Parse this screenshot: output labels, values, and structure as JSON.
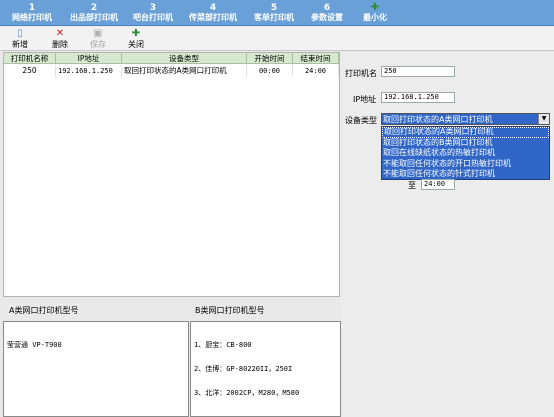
{
  "tabs": [
    {
      "num": "1",
      "label": "网络打印机"
    },
    {
      "num": "2",
      "label": "出品部打印机"
    },
    {
      "num": "3",
      "label": "吧台打印机"
    },
    {
      "num": "4",
      "label": "传菜部打印机"
    },
    {
      "num": "5",
      "label": "客单打印机"
    },
    {
      "num": "6",
      "label": "参数设置"
    },
    {
      "label": "最小化"
    }
  ],
  "toolbar": {
    "new": "新增",
    "delete": "删除",
    "save": "保存",
    "close": "关闭"
  },
  "table": {
    "headers": [
      "打印机名称",
      "IP地址",
      "设备类型",
      "开始时间",
      "结束时间"
    ],
    "rows": [
      [
        "250",
        "192.168.1.250",
        "取回打印状态的A类网口打印机",
        "00:00",
        "24:00"
      ]
    ]
  },
  "models": {
    "a_title": "A类网口打印机型号",
    "b_title": "B类网口打印机型号",
    "a_text": "莹营通 VP-T900",
    "b_lines": [
      "1、厨宝：CB-800",
      "2、佳博：GP-80220II，250I",
      "3、北洋：2002CP，M280，M580"
    ]
  },
  "form": {
    "name_label": "打印机名",
    "name_value": "250",
    "ip_label": "IP地址",
    "ip_value": "192.168.1.250",
    "type_label": "设备类型",
    "type_value": "取回打印状态的A类网口打印机",
    "end_label": "至",
    "end_value": "24:00",
    "options": [
      "取回打印状态的A类网口打印机",
      "取回打印状态的B类网口打印机",
      "取回在线缺纸状态的热敏打印机",
      "不能取回任何状态的开口热敏打印机",
      "不能取回任何状态的针式打印机"
    ]
  }
}
